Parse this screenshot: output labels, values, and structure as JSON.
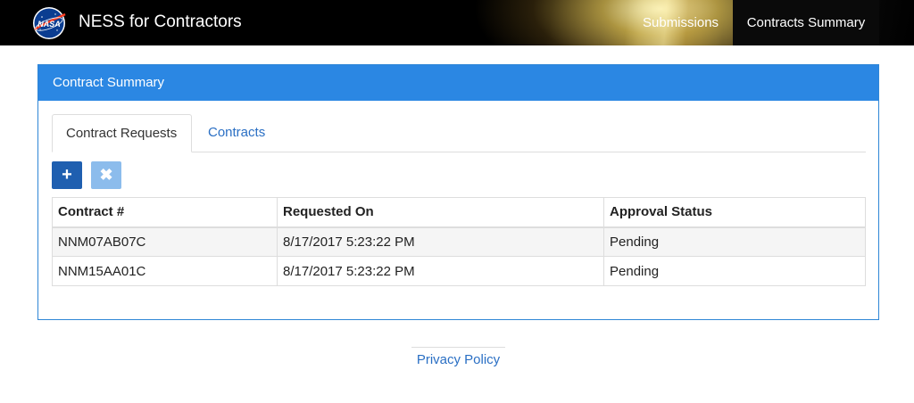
{
  "header": {
    "app_title": "NESS for Contractors",
    "logo_text": "NASA",
    "nav": [
      {
        "label": "Submissions"
      },
      {
        "label": "Contracts Summary"
      }
    ]
  },
  "panel": {
    "title": "Contract Summary",
    "tabs": [
      {
        "label": "Contract Requests",
        "active": true
      },
      {
        "label": "Contracts",
        "active": false
      }
    ],
    "toolbar": {
      "add_icon": "plus-icon",
      "remove_icon": "x-icon"
    },
    "table": {
      "columns": [
        "Contract #",
        "Requested On",
        "Approval Status"
      ],
      "rows": [
        {
          "contract": "NNM07AB07C",
          "requested_on": "8/17/2017 5:23:22 PM",
          "status": "Pending"
        },
        {
          "contract": "NNM15AA01C",
          "requested_on": "8/17/2017 5:23:22 PM",
          "status": "Pending"
        }
      ]
    }
  },
  "footer": {
    "privacy_label": "Privacy Policy"
  },
  "colors": {
    "panel_heading": "#2b87e3",
    "link": "#2a6fc4",
    "add_button": "#1f5fb0",
    "remove_button": "#8cbcec"
  }
}
